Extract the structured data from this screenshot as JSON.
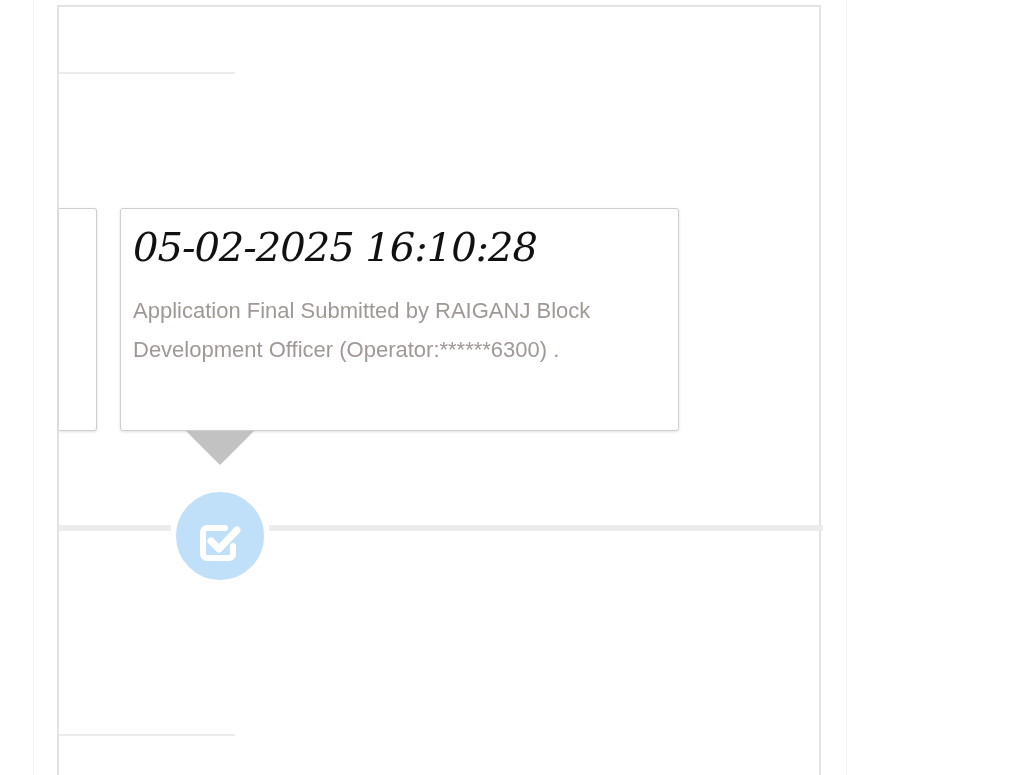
{
  "events": [
    {
      "kind": "hidden"
    },
    {
      "kind": "entry",
      "timestamp": "05-02-2025 16:10:28",
      "description": "Application Final Submitted by RAIGANJ Block Development Officer (Operator:******6300) ."
    }
  ]
}
